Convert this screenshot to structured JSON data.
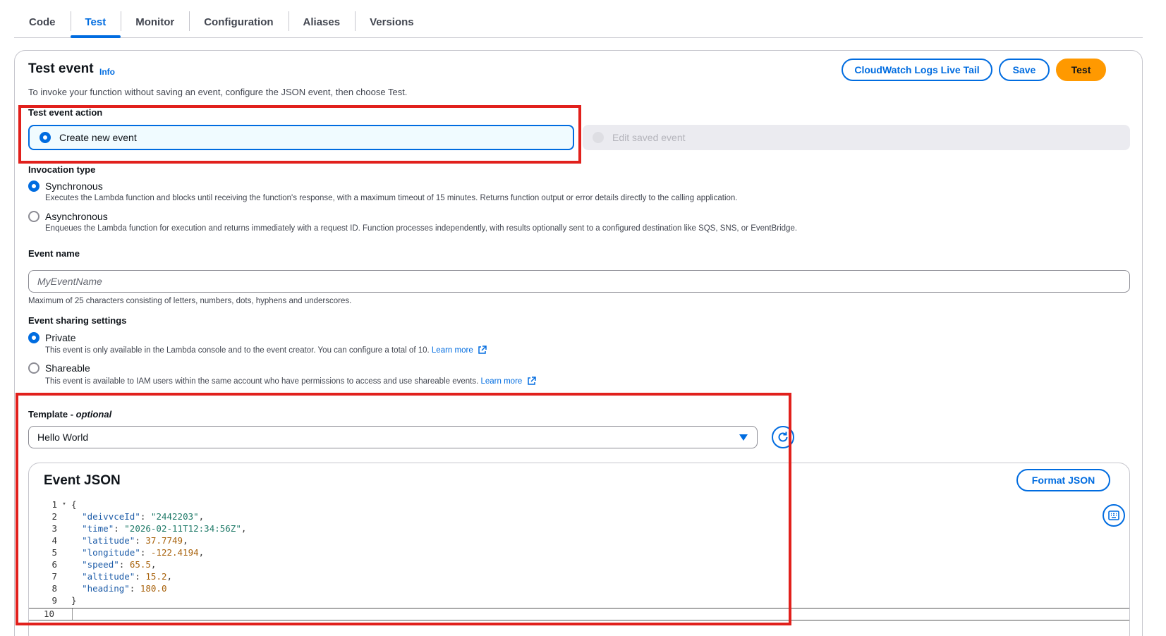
{
  "tabs": [
    "Code",
    "Test",
    "Monitor",
    "Configuration",
    "Aliases",
    "Versions"
  ],
  "header": {
    "title": "Test event",
    "info": "Info",
    "description": "To invoke your function without saving an event, configure the JSON event, then choose Test.",
    "buttons": {
      "live_tail": "CloudWatch Logs Live Tail",
      "save": "Save",
      "test": "Test"
    }
  },
  "test_event_action": {
    "label": "Test event action",
    "options": [
      "Create new event",
      "Edit saved event"
    ],
    "selected": "Create new event"
  },
  "invocation_type": {
    "label": "Invocation type",
    "options": [
      {
        "label": "Synchronous",
        "description": "Executes the Lambda function and blocks until receiving the function's response, with a maximum timeout of 15 minutes. Returns function output or error details directly to the calling application.",
        "selected": true
      },
      {
        "label": "Asynchronous",
        "description": "Enqueues the Lambda function for execution and returns immediately with a request ID. Function processes independently, with results optionally sent to a configured destination like SQS, SNS, or EventBridge.",
        "selected": false
      }
    ]
  },
  "event_name": {
    "label": "Event name",
    "placeholder": "MyEventName",
    "hint": "Maximum of 25 characters consisting of letters, numbers, dots, hyphens and underscores."
  },
  "event_sharing": {
    "label": "Event sharing settings",
    "options": [
      {
        "label": "Private",
        "description": "This event is only available in the Lambda console and to the event creator. You can configure a total of 10.",
        "link": "Learn more",
        "selected": true
      },
      {
        "label": "Shareable",
        "description": "This event is available to IAM users within the same account who have permissions to access and use shareable events.",
        "link": "Learn more",
        "selected": false
      }
    ]
  },
  "template": {
    "label": "Template - ",
    "label_optional": "optional",
    "value": "Hello World"
  },
  "event_json": {
    "title": "Event JSON",
    "format_button": "Format JSON",
    "line_numbers": [
      "1",
      "2",
      "3",
      "4",
      "5",
      "6",
      "7",
      "8",
      "9",
      "10"
    ],
    "lines": [
      {
        "indent": "",
        "key": "",
        "value": "",
        "punc": "{"
      },
      {
        "indent": "  ",
        "key": "\"deivvceId\"",
        "value": "\"2442203\"",
        "vtype": "str",
        "punc": ","
      },
      {
        "indent": "  ",
        "key": "\"time\"",
        "value": "\"2026-02-11T12:34:56Z\"",
        "vtype": "str",
        "punc": ","
      },
      {
        "indent": "  ",
        "key": "\"latitude\"",
        "value": "37.7749",
        "vtype": "num",
        "punc": ","
      },
      {
        "indent": "  ",
        "key": "\"longitude\"",
        "value": "-122.4194",
        "vtype": "num",
        "punc": ","
      },
      {
        "indent": "  ",
        "key": "\"speed\"",
        "value": "65.5",
        "vtype": "num",
        "punc": ","
      },
      {
        "indent": "  ",
        "key": "\"altitude\"",
        "value": "15.2",
        "vtype": "num",
        "punc": ","
      },
      {
        "indent": "  ",
        "key": "\"heading\"",
        "value": "180.0",
        "vtype": "num",
        "punc": ""
      },
      {
        "indent": "",
        "key": "",
        "value": "",
        "punc": "}"
      }
    ]
  },
  "colors": {
    "accent": "#006ce0",
    "primary_button": "#ff9900",
    "highlight": "#e1201c"
  },
  "icons": [
    "external-link-icon",
    "refresh-icon",
    "keyboard-icon",
    "caret-down-icon",
    "fold-arrow-icon"
  ]
}
